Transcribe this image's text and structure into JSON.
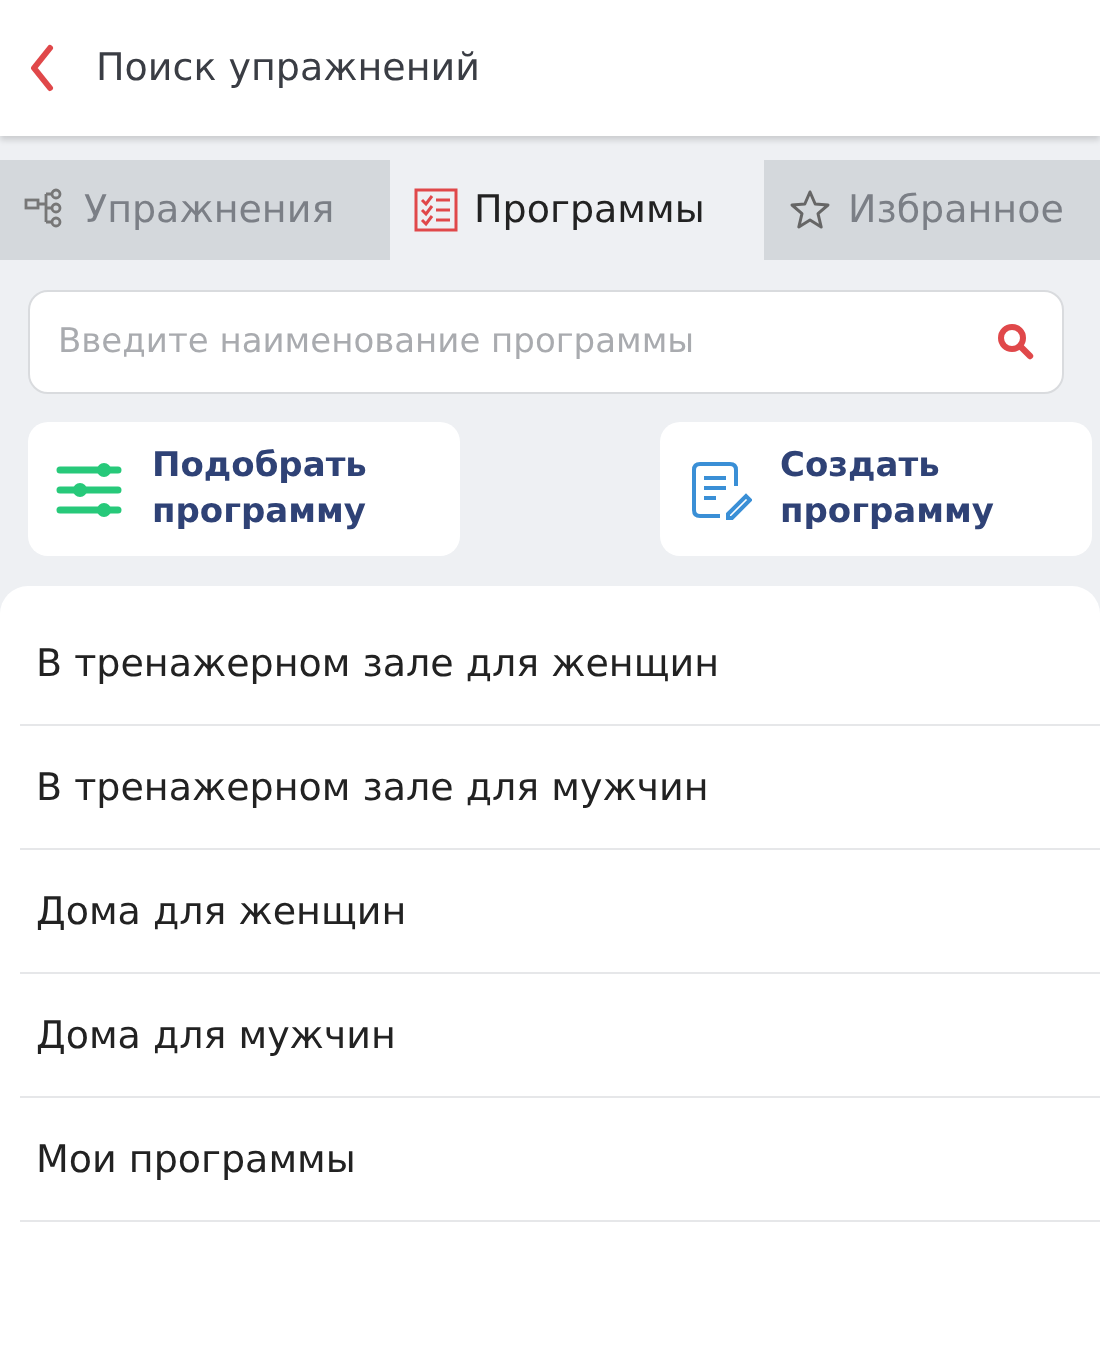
{
  "header": {
    "title": "Поиск упражнений"
  },
  "tabs": [
    {
      "label": "Упражнения",
      "kind": "tree",
      "selected": false
    },
    {
      "label": "Программы",
      "kind": "checklist",
      "selected": true
    },
    {
      "label": "Избранное",
      "kind": "star",
      "selected": false
    }
  ],
  "search": {
    "placeholder": "Введите наименование программы"
  },
  "actions": [
    {
      "label": "Подобрать программу",
      "kind": "sliders"
    },
    {
      "label": "Создать программу",
      "kind": "document"
    }
  ],
  "programs": [
    "В тренажерном зале для женщин",
    "В тренажерном зале для мужчин",
    "Дома для женщин",
    "Дома для мужчин",
    "Мои программы"
  ]
}
